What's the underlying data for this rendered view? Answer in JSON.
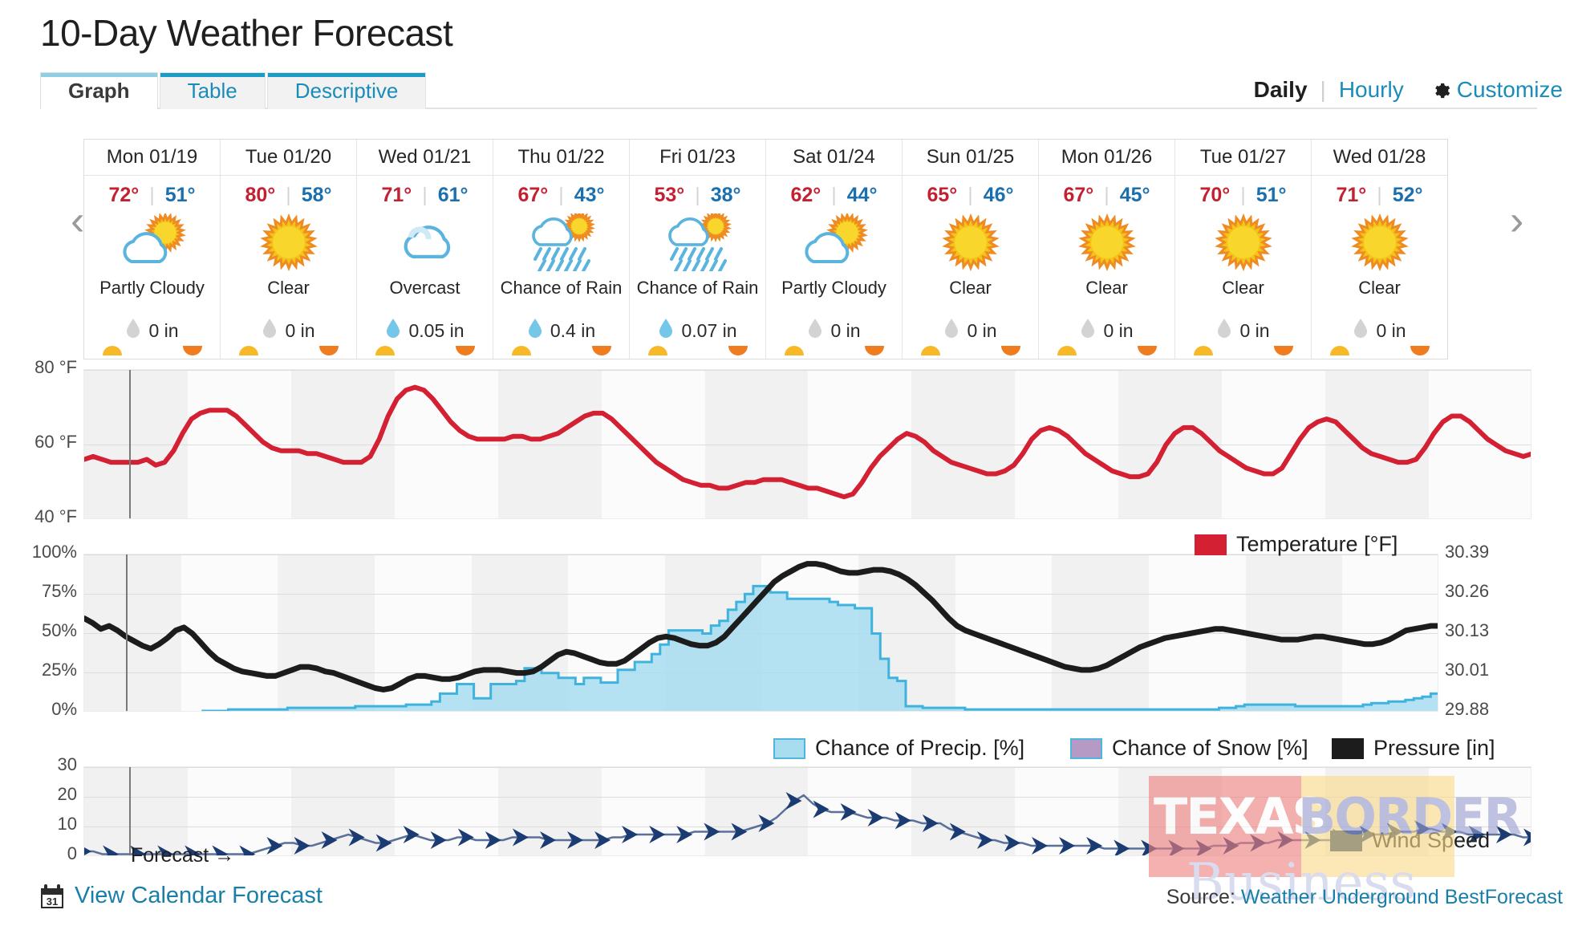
{
  "header": {
    "title": "10-Day Weather Forecast",
    "tabs": [
      {
        "label": "Graph",
        "active": true
      },
      {
        "label": "Table",
        "active": false
      },
      {
        "label": "Descriptive",
        "active": false
      }
    ],
    "daily_label": "Daily",
    "separator": "|",
    "hourly_label": "Hourly",
    "customize_label": "Customize",
    "gear_icon": "gear-icon"
  },
  "nav": {
    "prev": "‹",
    "next": "›"
  },
  "days": [
    {
      "date": "Mon 01/19",
      "high": "72°",
      "low": "51°",
      "sep": "|",
      "icon": "partly-cloudy-icon",
      "condition": "Partly Cloudy",
      "precip": "0 in",
      "precip_wet": false
    },
    {
      "date": "Tue 01/20",
      "high": "80°",
      "low": "58°",
      "sep": "|",
      "icon": "sunny-icon",
      "condition": "Clear",
      "precip": "0 in",
      "precip_wet": false
    },
    {
      "date": "Wed 01/21",
      "high": "71°",
      "low": "61°",
      "sep": "|",
      "icon": "overcast-icon",
      "condition": "Overcast",
      "precip": "0.05 in",
      "precip_wet": true
    },
    {
      "date": "Thu 01/22",
      "high": "67°",
      "low": "43°",
      "sep": "|",
      "icon": "rain-sun-icon",
      "condition": "Chance of Rain",
      "precip": "0.4 in",
      "precip_wet": true
    },
    {
      "date": "Fri 01/23",
      "high": "53°",
      "low": "38°",
      "sep": "|",
      "icon": "rain-sun-icon",
      "condition": "Chance of Rain",
      "precip": "0.07 in",
      "precip_wet": true
    },
    {
      "date": "Sat 01/24",
      "high": "62°",
      "low": "44°",
      "sep": "|",
      "icon": "partly-cloudy-icon",
      "condition": "Partly Cloudy",
      "precip": "0 in",
      "precip_wet": false
    },
    {
      "date": "Sun 01/25",
      "high": "65°",
      "low": "46°",
      "sep": "|",
      "icon": "sunny-icon",
      "condition": "Clear",
      "precip": "0 in",
      "precip_wet": false
    },
    {
      "date": "Mon 01/26",
      "high": "67°",
      "low": "45°",
      "sep": "|",
      "icon": "sunny-icon",
      "condition": "Clear",
      "precip": "0 in",
      "precip_wet": false
    },
    {
      "date": "Tue 01/27",
      "high": "70°",
      "low": "51°",
      "sep": "|",
      "icon": "sunny-icon",
      "condition": "Clear",
      "precip": "0 in",
      "precip_wet": false
    },
    {
      "date": "Wed 01/28",
      "high": "71°",
      "low": "52°",
      "sep": "|",
      "icon": "sunny-icon",
      "condition": "Clear",
      "precip": "0 in",
      "precip_wet": false
    }
  ],
  "colors": {
    "temperature": "#d32032",
    "precip": "#6ec6e8",
    "precip_fill": "#a8ddf0",
    "snow": "#b49ac4",
    "pressure": "#1c1c1c",
    "wind": "#1b3b73",
    "accent": "#1a8cba"
  },
  "forecast_note": "Forecast →",
  "footer": {
    "calendar_icon": "calendar-icon",
    "calendar_day": "31",
    "calendar_link": "View Calendar Forecast",
    "source_prefix": "Source: ",
    "source_link": "Weather Underground BestForecast"
  },
  "watermark": {
    "line1": "TEXAS",
    "line2": "BORDER",
    "line3": "Business"
  },
  "chart_data": [
    {
      "type": "line",
      "name": "temperature-chart",
      "title": "",
      "ylabel": "",
      "ylim": [
        32,
        84
      ],
      "yticks": [
        40,
        60,
        80
      ],
      "ytick_labels": [
        "40 °F",
        "60 °F",
        "80 °F"
      ],
      "grid": true,
      "legend": [
        {
          "label": "Temperature [°F]",
          "color": "#d32032"
        }
      ],
      "series": [
        {
          "name": "Temperature [°F]",
          "color": "#d32032",
          "values": [
            53,
            54,
            53,
            52,
            52,
            52,
            52,
            53,
            51,
            52,
            56,
            62,
            67,
            69,
            70,
            70,
            70,
            68,
            65,
            62,
            59,
            57,
            56,
            56,
            56,
            55,
            55,
            54,
            53,
            52,
            52,
            52,
            54,
            60,
            68,
            74,
            77,
            78,
            77,
            74,
            70,
            66,
            63,
            61,
            60,
            60,
            60,
            60,
            61,
            61,
            60,
            60,
            61,
            62,
            64,
            66,
            68,
            69,
            69,
            67,
            64,
            61,
            58,
            55,
            52,
            50,
            48,
            46,
            45,
            44,
            44,
            43,
            43,
            44,
            45,
            45,
            46,
            46,
            46,
            45,
            44,
            43,
            43,
            42,
            41,
            40,
            41,
            45,
            50,
            54,
            57,
            60,
            62,
            61,
            59,
            56,
            54,
            52,
            51,
            50,
            49,
            48,
            48,
            49,
            51,
            55,
            60,
            63,
            64,
            63,
            61,
            58,
            55,
            53,
            51,
            49,
            48,
            47,
            47,
            48,
            52,
            58,
            62,
            64,
            64,
            62,
            59,
            56,
            54,
            52,
            50,
            49,
            48,
            48,
            50,
            55,
            60,
            64,
            66,
            67,
            66,
            63,
            60,
            57,
            55,
            54,
            53,
            52,
            52,
            53,
            57,
            62,
            66,
            68,
            68,
            66,
            63,
            60,
            58,
            56,
            55,
            54,
            55
          ]
        }
      ]
    },
    {
      "type": "area",
      "name": "precip-pressure-chart",
      "ylabel": "",
      "ylim": [
        0,
        100
      ],
      "yticks": [
        0,
        25,
        50,
        75,
        100
      ],
      "ytick_labels": [
        "0%",
        "25%",
        "50%",
        "75%",
        "100%"
      ],
      "y2_ticks": [
        29.88,
        30.01,
        30.13,
        30.26,
        30.39
      ],
      "y2_tick_labels": [
        "29.88",
        "30.01",
        "30.13",
        "30.26",
        "30.39"
      ],
      "y2lim": [
        29.88,
        30.39
      ],
      "grid": true,
      "legend": [
        {
          "label": "Chance of Precip. [%]",
          "color": "#a8ddf0"
        },
        {
          "label": "Chance of Snow [%]",
          "color": "#b49ac4"
        },
        {
          "label": "Pressure [in]",
          "color": "#1c1c1c"
        }
      ],
      "series": [
        {
          "name": "Chance of Precip. [%]",
          "color": "#a8ddf0",
          "type": "area",
          "values": [
            0,
            0,
            0,
            0,
            0,
            0,
            0,
            0,
            0,
            0,
            0,
            0,
            0,
            0,
            1,
            1,
            1,
            2,
            2,
            2,
            2,
            2,
            2,
            2,
            3,
            3,
            3,
            3,
            3,
            3,
            3,
            3,
            4,
            4,
            4,
            4,
            4,
            4,
            5,
            5,
            5,
            7,
            12,
            12,
            18,
            18,
            9,
            9,
            18,
            18,
            18,
            20,
            28,
            28,
            25,
            25,
            22,
            22,
            18,
            22,
            22,
            19,
            19,
            27,
            27,
            32,
            32,
            37,
            43,
            52,
            52,
            52,
            52,
            50,
            55,
            58,
            65,
            70,
            75,
            80,
            80,
            76,
            76,
            72,
            72,
            72,
            72,
            72,
            70,
            68,
            68,
            66,
            66,
            50,
            34,
            22,
            20,
            4,
            4,
            3,
            3,
            3,
            3,
            3,
            2,
            2,
            2,
            2,
            2,
            2,
            2,
            2,
            2,
            2,
            2,
            2,
            2,
            2,
            2,
            2,
            2,
            2,
            2,
            2,
            2,
            2,
            2,
            2,
            2,
            2,
            2,
            2,
            2,
            2,
            3,
            3,
            4,
            5,
            5,
            5,
            5,
            5,
            5,
            4,
            4,
            4,
            4,
            4,
            4,
            4,
            4,
            5,
            6,
            6,
            7,
            7,
            8,
            9,
            10,
            12
          ]
        },
        {
          "name": "Chance of Snow [%]",
          "color": "#b49ac4",
          "type": "area",
          "values": [
            0,
            0,
            0,
            0,
            0,
            0,
            0,
            0,
            0,
            0,
            0,
            0,
            0,
            0,
            0,
            0,
            0,
            0,
            0,
            0,
            0,
            0,
            0,
            0,
            0,
            0,
            0,
            0,
            0,
            0,
            0,
            0,
            0,
            0,
            0,
            0,
            0,
            0,
            0,
            0,
            0,
            0,
            0,
            0,
            0,
            0,
            0,
            0,
            0,
            0,
            0,
            0,
            0,
            0,
            0,
            0,
            0,
            0,
            0,
            0,
            0,
            0,
            0,
            0,
            0,
            0,
            0,
            0,
            0,
            0,
            0,
            0,
            0,
            0,
            0,
            0,
            0,
            0,
            0,
            0,
            0,
            0,
            0,
            0,
            0,
            0,
            0,
            0,
            0,
            0,
            0,
            0,
            0,
            0,
            0,
            0,
            0,
            0,
            0,
            0,
            0,
            0,
            0,
            0,
            0,
            0,
            0,
            0,
            0,
            0,
            0,
            0,
            0,
            0,
            0,
            0,
            0,
            0,
            0,
            0,
            0,
            0,
            0,
            0,
            0,
            0,
            0,
            0,
            0,
            0,
            0,
            0,
            0,
            0,
            0,
            0,
            0,
            0,
            0,
            0,
            0,
            0,
            0,
            0,
            0,
            0,
            0,
            0,
            0,
            0,
            0,
            0,
            0,
            0,
            0,
            0,
            0,
            0,
            0,
            0
          ]
        },
        {
          "name": "Pressure [in]",
          "color": "#1c1c1c",
          "type": "line",
          "axis": "y2",
          "values": [
            60,
            57,
            53,
            55,
            52,
            48,
            45,
            42,
            40,
            43,
            47,
            52,
            54,
            50,
            44,
            38,
            33,
            30,
            27,
            25,
            24,
            23,
            22,
            22,
            24,
            26,
            28,
            28,
            27,
            25,
            24,
            22,
            20,
            18,
            16,
            14,
            13,
            14,
            17,
            20,
            22,
            22,
            21,
            20,
            20,
            21,
            23,
            25,
            26,
            26,
            26,
            25,
            24,
            24,
            25,
            28,
            32,
            36,
            38,
            37,
            35,
            33,
            31,
            30,
            30,
            32,
            36,
            40,
            44,
            47,
            48,
            47,
            45,
            43,
            42,
            42,
            44,
            48,
            54,
            60,
            66,
            72,
            78,
            84,
            88,
            91,
            94,
            96,
            96,
            95,
            93,
            91,
            90,
            90,
            91,
            92,
            92,
            91,
            89,
            86,
            82,
            77,
            72,
            66,
            60,
            55,
            52,
            50,
            48,
            46,
            44,
            42,
            40,
            38,
            36,
            34,
            32,
            30,
            28,
            27,
            26,
            26,
            27,
            29,
            32,
            35,
            38,
            41,
            43,
            45,
            47,
            48,
            49,
            50,
            51,
            52,
            53,
            53,
            52,
            51,
            50,
            49,
            48,
            47,
            46,
            46,
            46,
            47,
            48,
            48,
            47,
            46,
            45,
            44,
            43,
            43,
            44,
            46,
            49,
            52,
            53,
            54,
            55,
            55
          ]
        }
      ]
    },
    {
      "type": "line",
      "name": "wind-chart",
      "ylabel": "",
      "ylim": [
        0,
        32
      ],
      "yticks": [
        0,
        10,
        20,
        30
      ],
      "ytick_labels": [
        "0",
        "10",
        "20",
        "30"
      ],
      "grid": true,
      "legend": [
        {
          "label": "Wind Speed",
          "color": "#1b3b73"
        }
      ],
      "series": [
        {
          "name": "Wind Speed",
          "color": "#1b3b73",
          "values": [
            2,
            2,
            1,
            1,
            1,
            1,
            1,
            1,
            1,
            1,
            1,
            1,
            1,
            1,
            1,
            1,
            1,
            1,
            1,
            2,
            3,
            4,
            5,
            5,
            4,
            4,
            5,
            6,
            7,
            8,
            7,
            6,
            5,
            5,
            6,
            7,
            8,
            7,
            6,
            6,
            6,
            7,
            7,
            6,
            6,
            6,
            6,
            7,
            7,
            7,
            7,
            6,
            6,
            6,
            6,
            6,
            6,
            6,
            7,
            7,
            8,
            8,
            8,
            8,
            8,
            8,
            8,
            9,
            9,
            9,
            9,
            9,
            9,
            10,
            11,
            12,
            14,
            17,
            20,
            22,
            19,
            17,
            16,
            16,
            16,
            15,
            14,
            14,
            14,
            13,
            13,
            13,
            12,
            12,
            12,
            10,
            9,
            8,
            7,
            6,
            6,
            5,
            5,
            5,
            4,
            4,
            4,
            4,
            4,
            4,
            4,
            4,
            3,
            3,
            3,
            3,
            3,
            3,
            3,
            3,
            3,
            3,
            3,
            3,
            4,
            4,
            4,
            5,
            5,
            5,
            5,
            6,
            6,
            6,
            6,
            6,
            6,
            6,
            7,
            7,
            8,
            8,
            8,
            8,
            9,
            9,
            9,
            10,
            10,
            9,
            9,
            9,
            8,
            8,
            8,
            8,
            8,
            8,
            7,
            7
          ]
        }
      ]
    }
  ]
}
